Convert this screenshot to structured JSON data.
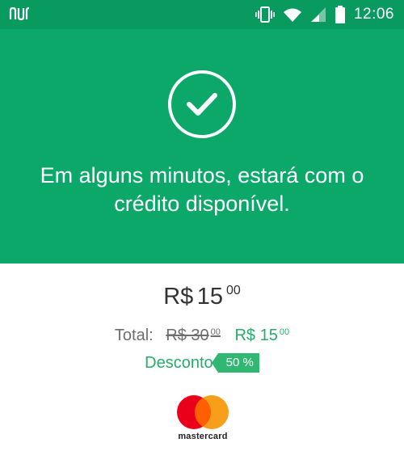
{
  "status_bar": {
    "app_icon": "nubank-logo-icon",
    "icons": [
      "vibrate-icon",
      "wifi-icon",
      "signal-icon",
      "battery-icon"
    ],
    "time": "12:06"
  },
  "hero": {
    "icon": "check-circle-icon",
    "message": "Em alguns minutos, estará com o crédito disponível.",
    "background_color": "#0ba86a"
  },
  "price": {
    "currency": "R$",
    "integer": "15",
    "cents": "00"
  },
  "total": {
    "label": "Total:",
    "old_integer": "R$ 30",
    "old_cents": "00",
    "new_integer": "R$ 15",
    "new_cents": "00"
  },
  "discount": {
    "label": "Desconto",
    "badge": "50 %"
  },
  "payment_method": {
    "brand_icon": "mastercard-logo-icon",
    "brand_text": "mastercard"
  },
  "colors": {
    "accent_green": "#27ad6b",
    "status_bar": "#089a5f"
  }
}
